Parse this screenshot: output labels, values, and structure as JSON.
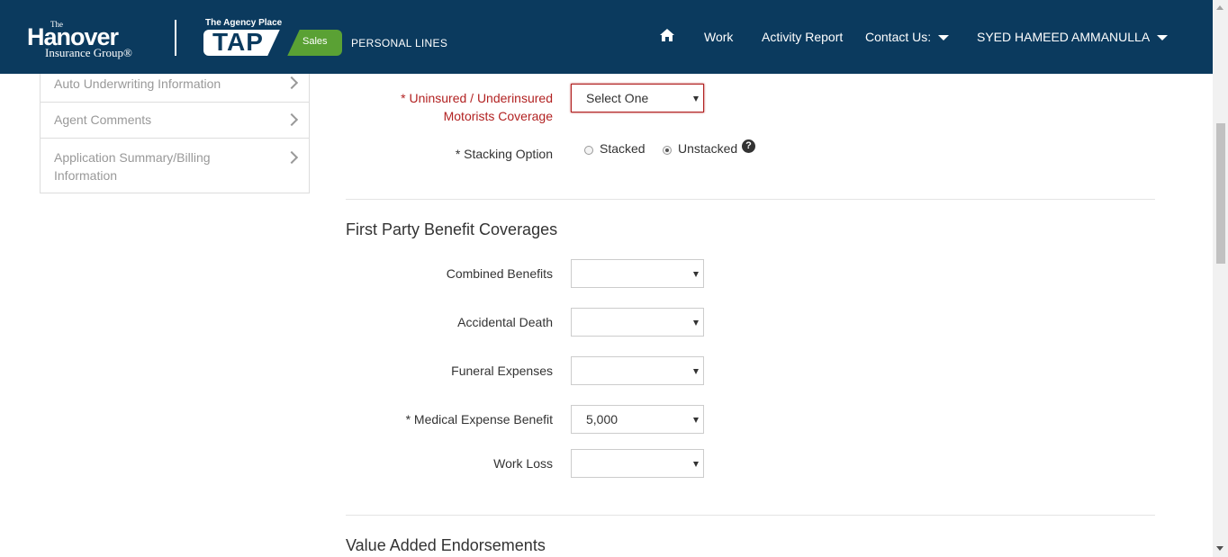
{
  "header": {
    "brand_the": "The",
    "brand_name": "Hanover",
    "brand_sub": "Insurance Group®",
    "tap_top": "The Agency Place",
    "tap_word": "TAP",
    "tap_sales": "Sales",
    "personal_lines": "PERSONAL LINES",
    "nav": {
      "home_icon": "home-icon",
      "work": "Work",
      "activity_report": "Activity Report",
      "contact_us": "Contact Us:",
      "user": "SYED HAMEED AMMANULLA"
    }
  },
  "sidebar": {
    "items": [
      {
        "label": "Auto Underwriting Information"
      },
      {
        "label": "Agent Comments"
      },
      {
        "label": "Application Summary/Billing Information"
      }
    ]
  },
  "form": {
    "um_label_line1": "* Uninsured / Underinsured",
    "um_label_line2": "Motorists Coverage",
    "um_value": "Select One",
    "stacking_label": "* Stacking Option",
    "stacked_label": "Stacked",
    "unstacked_label": "Unstacked",
    "stacking_selected": "Unstacked",
    "help_glyph": "?"
  },
  "first_party": {
    "title": "First Party Benefit Coverages",
    "fields": [
      {
        "label": "Combined Benefits",
        "value": ""
      },
      {
        "label": "Accidental Death",
        "value": ""
      },
      {
        "label": "Funeral Expenses",
        "value": ""
      },
      {
        "label": "* Medical Expense Benefit",
        "value": "5,000"
      },
      {
        "label": "Work Loss",
        "value": ""
      }
    ]
  },
  "value_added": {
    "title": "Value Added Endorsements"
  },
  "colors": {
    "header_bg": "#0b3a5e",
    "tap_green": "#5aa134",
    "error_red": "#b22222"
  }
}
